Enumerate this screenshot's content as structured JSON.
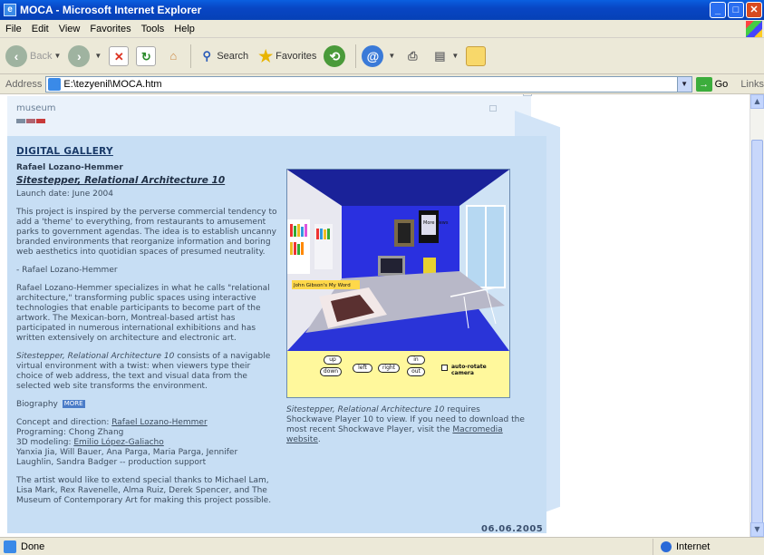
{
  "window": {
    "title": "MOCA - Microsoft Internet Explorer",
    "icon": "ie-page-icon"
  },
  "menu": [
    "File",
    "Edit",
    "View",
    "Favorites",
    "Tools",
    "Help"
  ],
  "toolbar": {
    "back": "Back",
    "search": "Search",
    "favorites": "Favorites"
  },
  "address": {
    "label": "Address",
    "value": "E:\\tezyenil\\MOCA.htm",
    "go": "Go",
    "links": "Links"
  },
  "page": {
    "museum": "museum",
    "swatch_colors": [
      "#7d8da0",
      "#b06470",
      "#c83a3a"
    ],
    "section": "DIGITAL GALLERY",
    "artist": "Rafael Lozano-Hemmer",
    "work_title": "Sitestepper, Relational Architecture 10",
    "launch": "Launch date: June 2004",
    "intro": "This project is inspired by the perverse commercial tendency to add a 'theme' to everything, from restaurants to amusement parks to government agendas. The idea is to establish uncanny branded environments that reorganize information and boring web aesthetics into quotidian spaces of presumed neutrality.",
    "signature": "- Rafael Lozano-Hemmer",
    "bio_para": "Rafael Lozano-Hemmer specializes in what he calls \"relational architecture,\" transforming public spaces using interactive technologies that enable participants to become part of the artwork. The Mexican-born, Montreal-based artist has participated in numerous international exhibitions and has written extensively on architecture and electronic art.",
    "desc_italic": "Sitestepper, Relational Architecture 10",
    "desc_rest": " consists of a navigable virtual environment with a twist: when viewers type their choice of web address, the text and visual data from the selected web site transforms the environment.",
    "biography_label": "Biography",
    "more_label": "MORE",
    "credits": {
      "concept_label": "Concept and direction: ",
      "concept_name": "Rafael Lozano-Hemmer",
      "programming": "Programing: Chong Zhang",
      "modeling_label": "3D modeling: ",
      "modeling_name": "Emilio López-Galiacho",
      "support": "Yanxia Jia, Will Bauer, Ana Parga, Maria Parga, Jennifer Laughlin, Sandra Badger -- production support"
    },
    "thanks": "The artist would like to extend special thanks to Michael Lam, Lisa Mark, Rex Ravenelle, Alma Ruiz, Derek Spencer, and The Museum of Contemporary Art for making this project possible.",
    "image": {
      "room_sign": "John Gibson's My Word",
      "poster_text": "More News",
      "buttons": [
        "up",
        "down",
        "left",
        "right",
        "in",
        "out"
      ],
      "checkbox_label": "auto-rotate camera"
    },
    "caption_italic": "Sitestepper, Relational Architecture 10",
    "caption_rest": " requires Shockwave Player 10 to view. If you need to download the most recent Shockwave Player, visit the ",
    "caption_link": "Macromedia website",
    "caption_end": ".",
    "date": "06.06.2005"
  },
  "status": {
    "text": "Done",
    "zone": "Internet"
  }
}
